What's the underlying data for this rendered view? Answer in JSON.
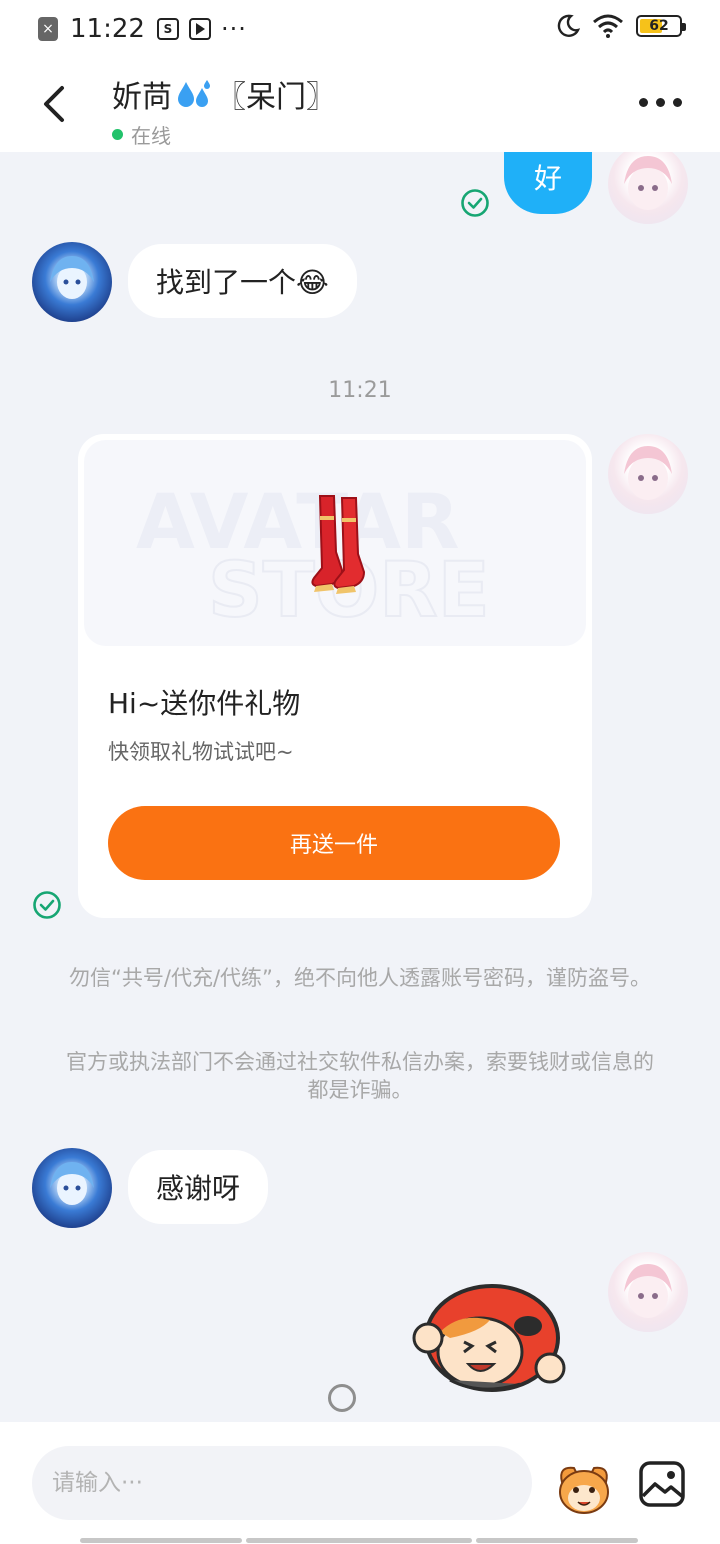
{
  "status_bar": {
    "time": "11:22",
    "notif_badge": "×",
    "shop_icon": "S",
    "more_dots": "···",
    "battery_level": "62",
    "battery_percent": 62
  },
  "header": {
    "name": "妡苘",
    "tag": "〖呆门〗",
    "status": "在线"
  },
  "messages": {
    "m1": {
      "text": "好"
    },
    "m2": {
      "text": "找到了一个😂"
    },
    "time": "11:21",
    "card": {
      "watermark_line1": "AVATAR",
      "watermark_line2": "STORE",
      "title": "Hi~送你件礼物",
      "subtitle": "快领取礼物试试吧~",
      "button": "再送一件"
    },
    "notice1": "勿信“共号/代充/代练”，绝不向他人透露账号密码，谨防盗号。",
    "notice2": "官方或执法部门不会通过社交软件私信办案，索要钱财或信息的都是诈骗。",
    "m3": {
      "text": "感谢呀"
    }
  },
  "input": {
    "placeholder": "请输入···"
  },
  "colors": {
    "accent_blue": "#1fb0f8",
    "gift_orange": "#fa7212",
    "online_green": "#22c26b",
    "check_green": "#17a673"
  }
}
